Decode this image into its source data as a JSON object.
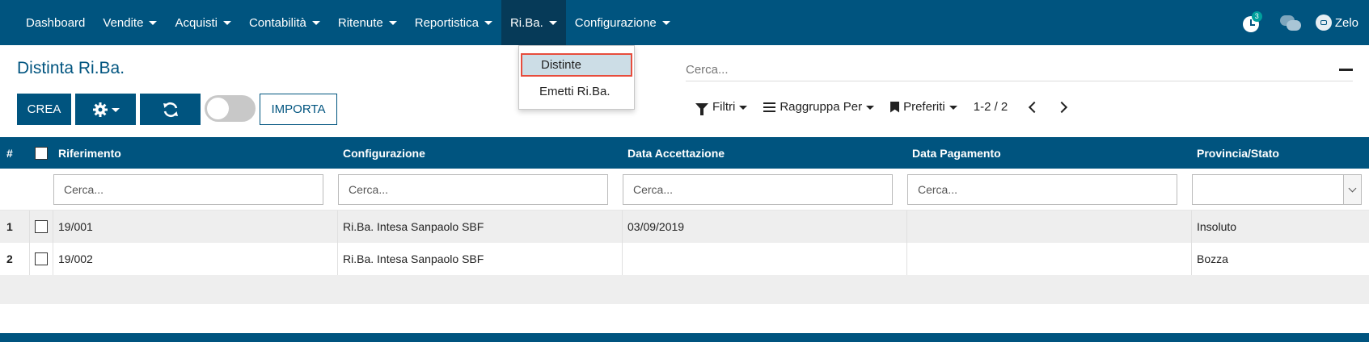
{
  "nav": {
    "items": [
      {
        "label": "Dashboard",
        "caret": false
      },
      {
        "label": "Vendite",
        "caret": true
      },
      {
        "label": "Acquisti",
        "caret": true
      },
      {
        "label": "Contabilità",
        "caret": true
      },
      {
        "label": "Ritenute",
        "caret": true
      },
      {
        "label": "Reportistica",
        "caret": true
      },
      {
        "label": "Ri.Ba.",
        "caret": true,
        "active": true
      },
      {
        "label": "Configurazione",
        "caret": true
      }
    ],
    "activity_count": "3",
    "user_name": "Zelo"
  },
  "dropdown": {
    "items": [
      "Distinte",
      "Emetti Ri.Ba."
    ]
  },
  "page": {
    "title": "Distinta Ri.Ba.",
    "create_label": "CREA",
    "import_label": "IMPORTA"
  },
  "search": {
    "placeholder": "Cerca...",
    "filters_label": "Filtri",
    "groupby_label": "Raggruppa Per",
    "favorites_label": "Preferiti",
    "pager": "1-2 / 2"
  },
  "table": {
    "headers": {
      "num": "#",
      "riferimento": "Riferimento",
      "configurazione": "Configurazione",
      "data_accettazione": "Data Accettazione",
      "data_pagamento": "Data Pagamento",
      "provincia_stato": "Provincia/Stato"
    },
    "filter_placeholder": "Cerca...",
    "rows": [
      {
        "num": "1",
        "riferimento": "19/001",
        "configurazione": "Ri.Ba. Intesa Sanpaolo SBF",
        "data_accettazione": "03/09/2019",
        "data_pagamento": "",
        "stato": "Insoluto"
      },
      {
        "num": "2",
        "riferimento": "19/002",
        "configurazione": "Ri.Ba. Intesa Sanpaolo SBF",
        "data_accettazione": "",
        "data_pagamento": "",
        "stato": "Bozza"
      }
    ]
  },
  "colors": {
    "brand": "#00547f",
    "active_nav": "#063a58",
    "highlight_border": "#e74c3c",
    "badge": "#00a09d"
  }
}
